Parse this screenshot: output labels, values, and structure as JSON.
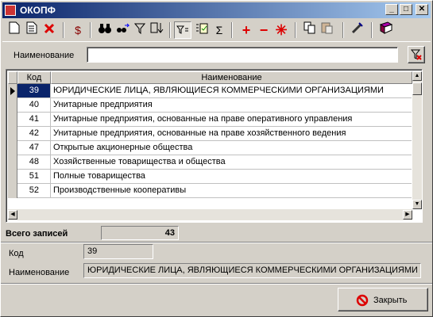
{
  "window": {
    "title": "ОКОПФ",
    "min": "_",
    "max": "□",
    "close": "✕"
  },
  "toolbar": {
    "icons": [
      "new-document-icon",
      "copy-document-icon",
      "delete-icon",
      "money-icon",
      "binoculars-icon",
      "find-next-icon",
      "filter-icon",
      "sort-icon",
      "filter-list-icon",
      "select-all-icon",
      "sum-icon",
      "plus-icon",
      "minus-icon",
      "asterisk-icon",
      "copy-icon",
      "paste-icon",
      "tools-icon",
      "book-icon"
    ]
  },
  "filter": {
    "label": "Наименование",
    "value": ""
  },
  "grid": {
    "headers": {
      "code": "Код",
      "name": "Наименование"
    },
    "rows": [
      {
        "code": "39",
        "name": "ЮРИДИЧЕСКИЕ ЛИЦА, ЯВЛЯЮЩИЕСЯ КОММЕРЧЕСКИМИ ОРГАНИЗАЦИЯМИ"
      },
      {
        "code": "40",
        "name": "Унитарные предприятия"
      },
      {
        "code": "41",
        "name": "Унитарные предприятия, основанные на праве оперативного управления"
      },
      {
        "code": "42",
        "name": "Унитарные предприятия, основанные на праве хозяйственного ведения"
      },
      {
        "code": "47",
        "name": "Открытые акционерные общества"
      },
      {
        "code": "48",
        "name": "Хозяйственные товарищества и общества"
      },
      {
        "code": "51",
        "name": "Полные товарищества"
      },
      {
        "code": "52",
        "name": "Производственные кооперативы"
      }
    ]
  },
  "total": {
    "label": "Всего записей",
    "value": "43"
  },
  "detail": {
    "code_label": "Код",
    "code_value": "39",
    "name_label": "Наименование",
    "name_value": "ЮРИДИЧЕСКИЕ ЛИЦА, ЯВЛЯЮЩИЕСЯ КОММЕРЧЕСКИМИ ОРГАНИЗАЦИЯМИ"
  },
  "close_button": {
    "label": "Закрыть"
  }
}
